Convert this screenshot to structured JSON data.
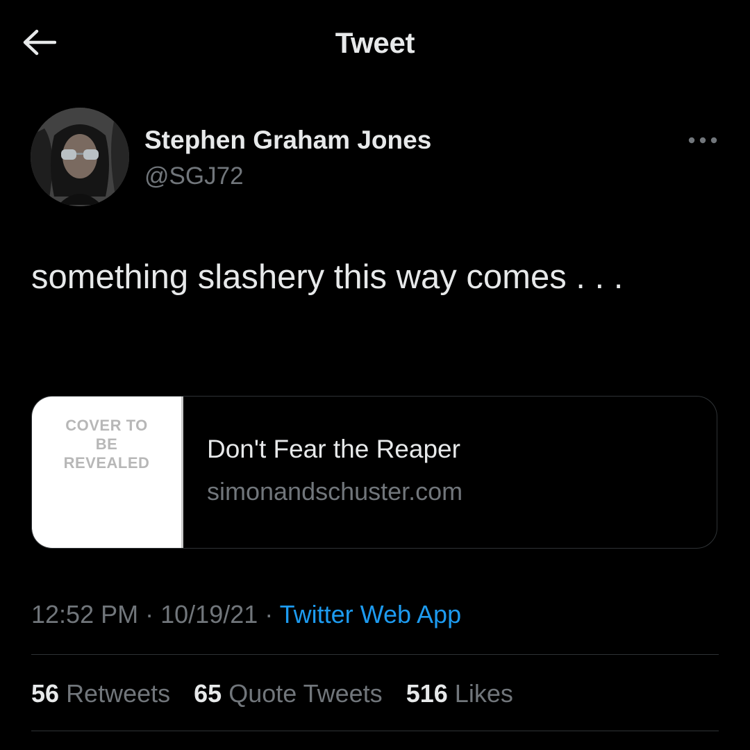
{
  "header": {
    "title": "Tweet",
    "back_icon": "arrow-left-icon"
  },
  "author": {
    "name": "Stephen Graham Jones",
    "handle": "@SGJ72",
    "avatar_icon": "avatar"
  },
  "tweet": {
    "text": "something slashery this way comes . . ."
  },
  "card": {
    "thumbnail_text": "COVER TO BE REVEALED",
    "title": "Don't Fear the Reaper",
    "domain": "simonandschuster.com"
  },
  "meta": {
    "time": "12:52 PM",
    "separator": "·",
    "date": "10/19/21",
    "source": "Twitter Web App"
  },
  "stats": {
    "retweets": {
      "count": "56",
      "label": "Retweets"
    },
    "quote_tweets": {
      "count": "65",
      "label": "Quote Tweets"
    },
    "likes": {
      "count": "516",
      "label": "Likes"
    }
  },
  "colors": {
    "background": "#000000",
    "text": "#e7e9ea",
    "secondary_text": "#71767b",
    "link": "#1d9bf0",
    "border": "#2f3336"
  }
}
